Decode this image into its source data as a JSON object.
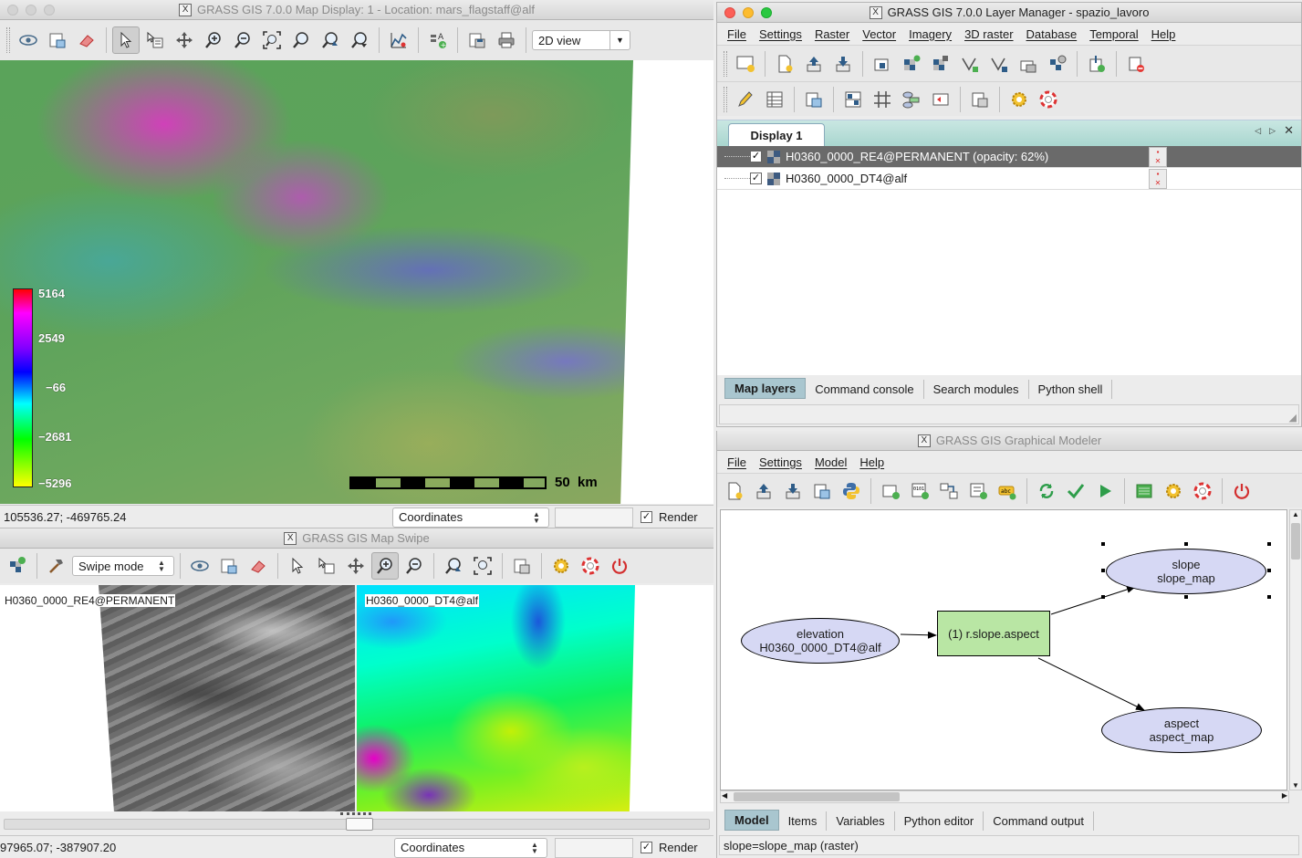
{
  "map_display": {
    "title": "GRASS GIS 7.0.0 Map Display: 1  - Location: mars_flagstaff@alf",
    "view_mode": "2D view",
    "legend": {
      "values": [
        "5164",
        "2549",
        "−66",
        "−2681",
        "−5296"
      ]
    },
    "scalebar_label": "50  km",
    "coords": "105536.27; -469765.24",
    "mode": "Coordinates",
    "render_label": "Render"
  },
  "layer_manager": {
    "title": "GRASS GIS 7.0.0 Layer Manager - spazio_lavoro",
    "menu": [
      "File",
      "Settings",
      "Raster",
      "Vector",
      "Imagery",
      "3D raster",
      "Database",
      "Temporal",
      "Help"
    ],
    "display_tab": "Display 1",
    "layers": [
      {
        "name": "H0360_0000_RE4@PERMANENT (opacity: 62%)",
        "checked": true
      },
      {
        "name": "H0360_0000_DT4@alf",
        "checked": true
      }
    ],
    "bottom_tabs": [
      "Map layers",
      "Command console",
      "Search modules",
      "Python shell"
    ]
  },
  "map_swipe": {
    "title": "GRASS GIS Map Swipe",
    "swipe_mode": "Swipe mode",
    "left_layer": "H0360_0000_RE4@PERMANENT",
    "right_layer": "H0360_0000_DT4@alf",
    "coords": "97965.07; -387907.20",
    "mode": "Coordinates",
    "render_label": "Render"
  },
  "modeler": {
    "title": "GRASS GIS Graphical Modeler",
    "menu": [
      "File",
      "Settings",
      "Model",
      "Help"
    ],
    "nodes": {
      "elevation": {
        "line1": "elevation",
        "line2": "H0360_0000_DT4@alf"
      },
      "action": "(1) r.slope.aspect",
      "slope": {
        "line1": "slope",
        "line2": "slope_map"
      },
      "aspect": {
        "line1": "aspect",
        "line2": "aspect_map"
      }
    },
    "bottom_tabs": [
      "Model",
      "Items",
      "Variables",
      "Python editor",
      "Command output"
    ],
    "status": "slope=slope_map (raster)"
  }
}
